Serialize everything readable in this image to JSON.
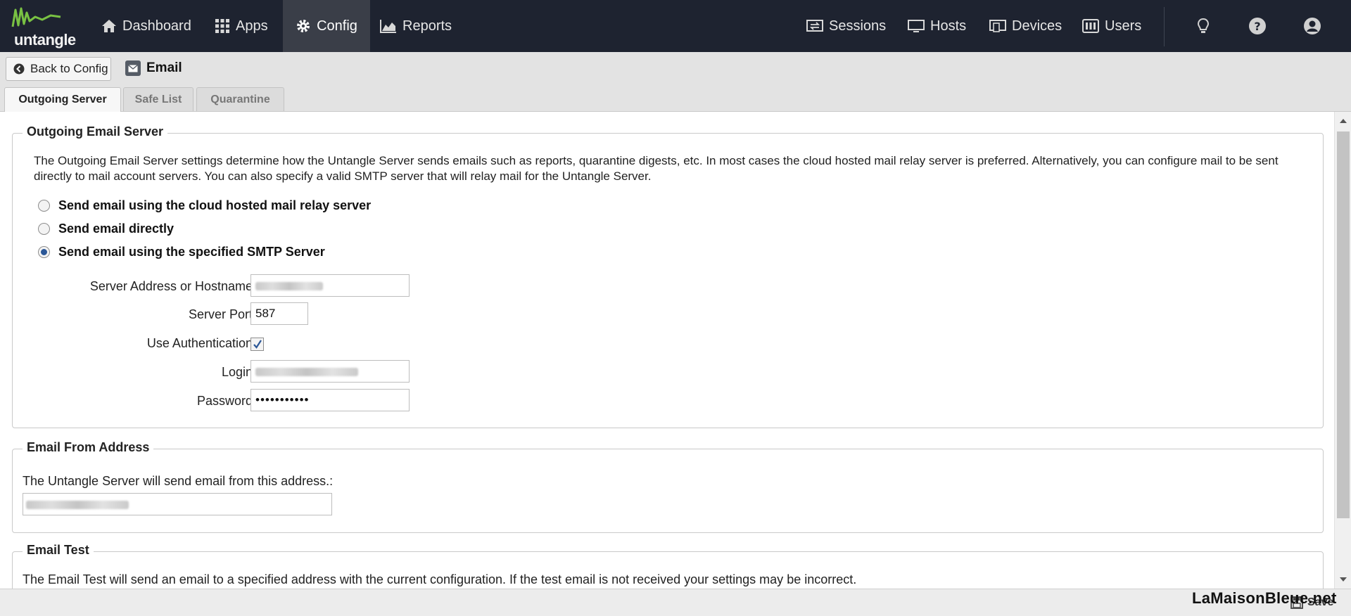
{
  "app": {
    "logo_text": "untangle",
    "accent_color": "#79c143"
  },
  "nav": {
    "dashboard": "Dashboard",
    "apps": "Apps",
    "config": "Config",
    "reports": "Reports",
    "sessions": "Sessions",
    "hosts": "Hosts",
    "devices": "Devices",
    "users": "Users"
  },
  "subheader": {
    "back_label": "Back to Config",
    "title": "Email"
  },
  "tabs": [
    "Outgoing Server",
    "Safe List",
    "Quarantine"
  ],
  "outgoing": {
    "legend": "Outgoing Email Server",
    "description": "The Outgoing Email Server settings determine how the Untangle Server sends emails such as reports, quarantine digests, etc. In most cases the cloud hosted mail relay server is preferred. Alternatively, you can configure mail to be sent directly to mail account servers. You can also specify a valid SMTP server that will relay mail for the Untangle Server.",
    "options": [
      "Send email using the cloud hosted mail relay server",
      "Send email directly",
      "Send email using the specified SMTP Server"
    ],
    "selected_option": "Send email using the specified SMTP Server",
    "server_label": "Server Address or Hostname:",
    "port_label": "Server Port:",
    "port_value": "587",
    "auth_label": "Use Authentication:",
    "auth_checked": true,
    "login_label": "Login:",
    "password_label": "Password:",
    "password_value": "•••••••••••"
  },
  "from": {
    "legend": "Email From Address",
    "description": "The Untangle Server will send email from this address.:"
  },
  "test": {
    "legend": "Email Test",
    "description": "The Email Test will send an email to a specified address with the current configuration. If the test email is not received your settings may be incorrect."
  },
  "footer": {
    "watermark": "LaMaisonBleue.net",
    "save_label": "Save"
  }
}
